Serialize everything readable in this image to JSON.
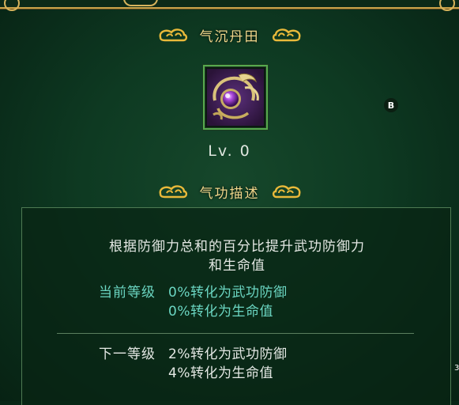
{
  "skill": {
    "name": "气沉丹田",
    "level_text": "Lv. 0",
    "badge": "B"
  },
  "description_header": "气功描述",
  "description": {
    "line1": "根据防御力总和的百分比提升武功防御力",
    "line2": "和生命值"
  },
  "current_level": {
    "label": "当前等级",
    "stat1": "0%转化为武功防御",
    "stat2": "0%转化为生命值"
  },
  "next_level": {
    "label": "下一等级",
    "stat1": "2%转化为武功防御",
    "stat2": "4%转化为生命值"
  },
  "edge_mark": "3",
  "colors": {
    "title_gold": "#f1d78b",
    "frame_green": "#56a94e",
    "current_cyan": "#6bd6c2",
    "text_white": "#e4e8e4"
  },
  "icons": [
    "cloud-ornament-icon",
    "qigong-skill-icon"
  ]
}
